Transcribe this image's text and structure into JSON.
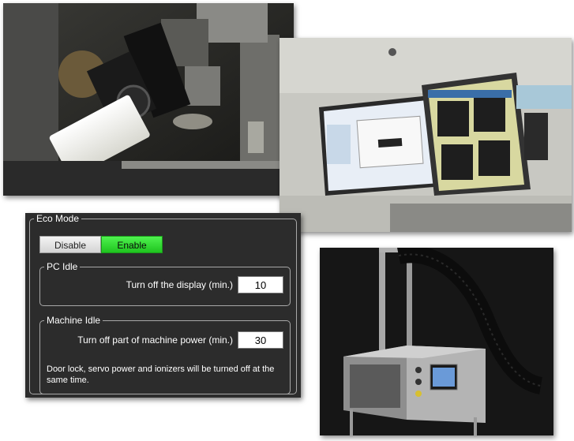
{
  "eco_mode": {
    "title": "Eco Mode",
    "disable_label": "Disable",
    "enable_label": "Enable",
    "selected": "Enable",
    "colors": {
      "enabled": "#2ee02e",
      "panel_bg": "#2c2c2c",
      "border": "#a8a8a8"
    }
  },
  "pc_idle": {
    "title": "PC Idle",
    "label": "Turn off the display (min.)",
    "value": "10"
  },
  "machine_idle": {
    "title": "Machine Idle",
    "label": "Turn off part of machine power (min.)",
    "value": "30",
    "note": "Door lock, servo power and ionizers will be turned off at the same time."
  },
  "photos": {
    "camera": "camera-lighting-photo",
    "monitors": "monitors-photo",
    "machine": "machine-unit-photo"
  }
}
